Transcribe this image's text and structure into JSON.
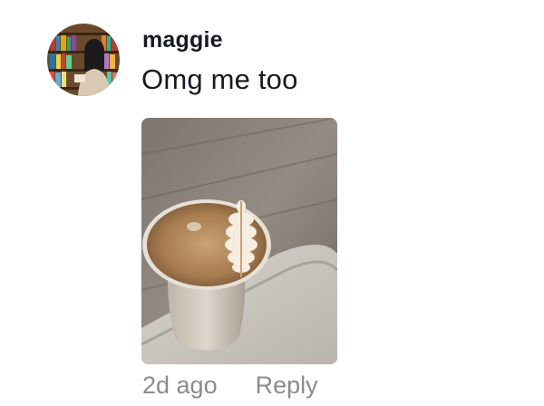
{
  "comment": {
    "username": "maggie",
    "text": "Omg me too",
    "time_ago": "2d ago",
    "reply_label": "Reply"
  },
  "icons": {
    "avatar": "user-avatar-photo",
    "attachment": "latte-art-photo"
  }
}
